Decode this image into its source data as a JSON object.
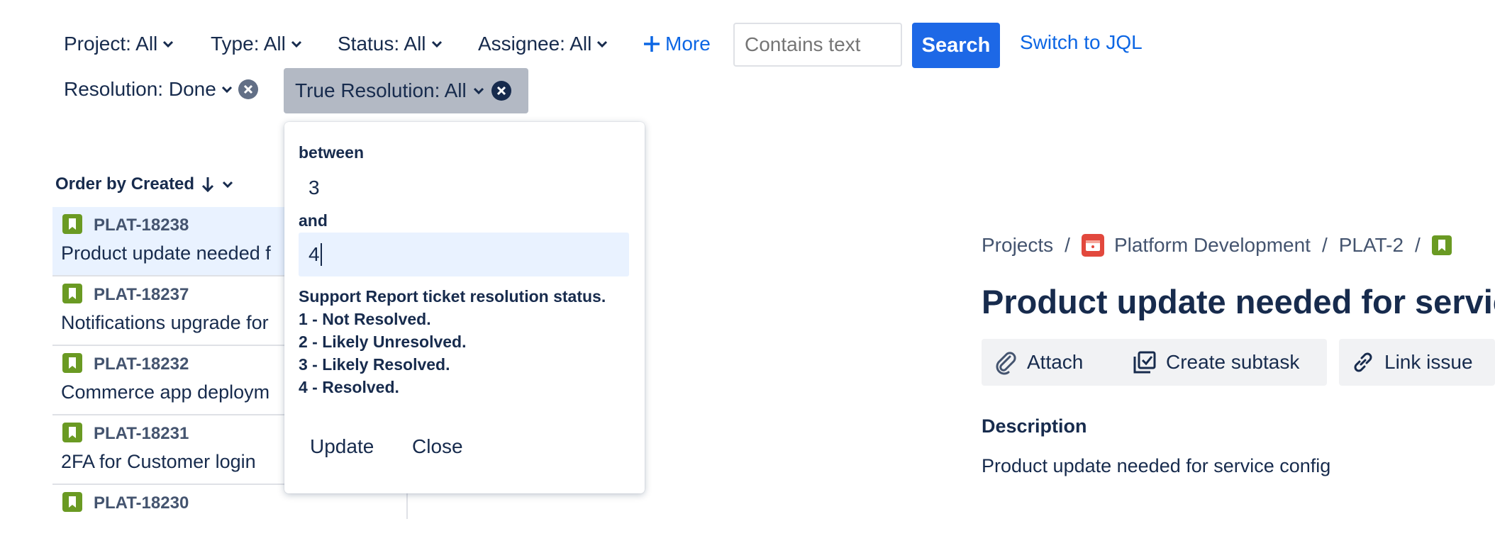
{
  "filters": {
    "project": "Project: All",
    "type": "Type: All",
    "status": "Status: All",
    "assignee": "Assignee: All",
    "more": "More",
    "text_placeholder": "Contains text",
    "search": "Search",
    "switch_jql": "Switch to JQL",
    "resolution": "Resolution: Done",
    "true_resolution": "True Resolution: All"
  },
  "order": {
    "label": "Order by Created"
  },
  "issues": [
    {
      "key": "PLAT-18238",
      "title": "Product update needed f"
    },
    {
      "key": "PLAT-18237",
      "title": "Notifications upgrade for"
    },
    {
      "key": "PLAT-18232",
      "title": "Commerce app deploym"
    },
    {
      "key": "PLAT-18231",
      "title": "2FA for Customer login"
    },
    {
      "key": "PLAT-18230",
      "title": ""
    }
  ],
  "popup": {
    "between_label": "between",
    "between_value": "3",
    "and_label": "and",
    "and_value": "4",
    "help_lines": [
      "Support Report ticket resolution status.",
      "1 - Not Resolved.",
      "2 - Likely Unresolved.",
      "3 - Likely Resolved.",
      "4 - Resolved."
    ],
    "update": "Update",
    "close": "Close"
  },
  "breadcrumb": {
    "projects": "Projects",
    "project": "Platform Development",
    "parent": "PLAT-2",
    "separator": "/"
  },
  "detail": {
    "title": "Product update needed for service",
    "attach": "Attach",
    "create_subtask": "Create subtask",
    "link_issue": "Link issue",
    "description_heading": "Description",
    "description_text": "Product update needed for service config"
  },
  "colors": {
    "accent": "#1d68e6",
    "link": "#0c66e4",
    "story_icon": "#6a9a23",
    "project_icon": "#e2483d"
  }
}
